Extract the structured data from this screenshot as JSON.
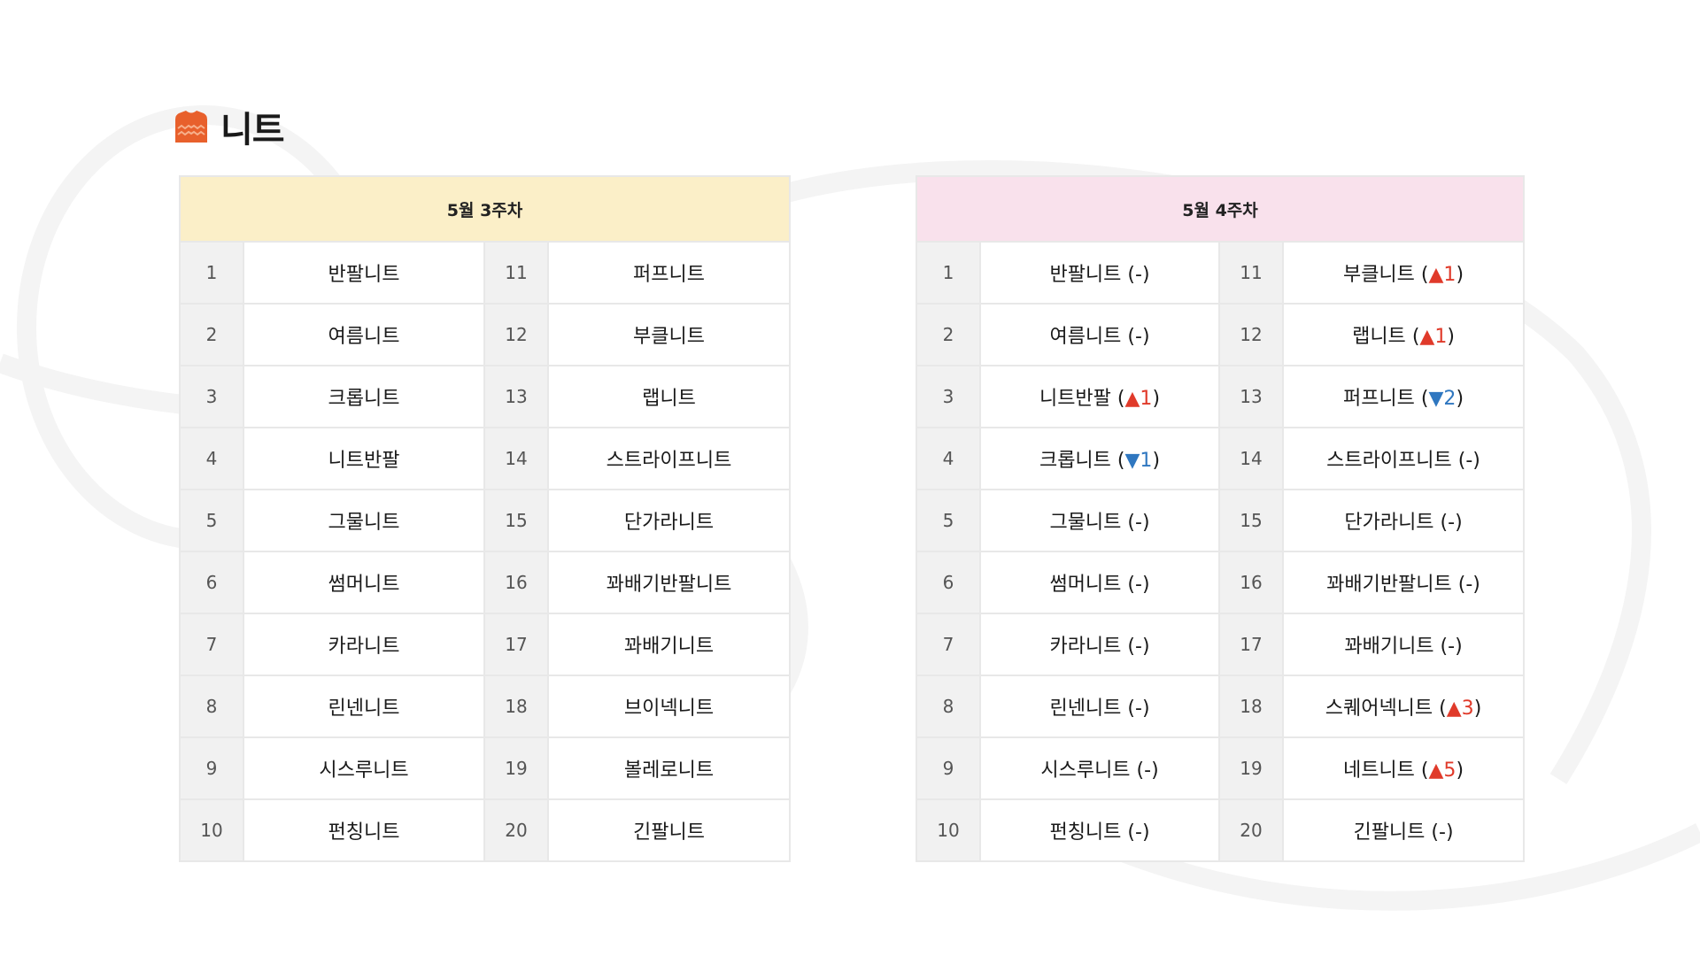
{
  "title": {
    "text": "니트",
    "icon": "sweater-icon"
  },
  "colors": {
    "week1_header_bg": "#fbefc8",
    "week2_header_bg": "#f9e1ec",
    "rank_up": "#e03a2a",
    "rank_down": "#2f77c0",
    "icon": "#e8602c"
  },
  "week1": {
    "header": "5월 3주차",
    "rows": [
      {
        "n1": "1",
        "name1": "반팔니트",
        "n2": "11",
        "name2": "퍼프니트"
      },
      {
        "n1": "2",
        "name1": "여름니트",
        "n2": "12",
        "name2": "부클니트"
      },
      {
        "n1": "3",
        "name1": "크롭니트",
        "n2": "13",
        "name2": "랩니트"
      },
      {
        "n1": "4",
        "name1": "니트반팔",
        "n2": "14",
        "name2": "스트라이프니트"
      },
      {
        "n1": "5",
        "name1": "그물니트",
        "n2": "15",
        "name2": "단가라니트"
      },
      {
        "n1": "6",
        "name1": "썸머니트",
        "n2": "16",
        "name2": "꽈배기반팔니트"
      },
      {
        "n1": "7",
        "name1": "카라니트",
        "n2": "17",
        "name2": "꽈배기니트"
      },
      {
        "n1": "8",
        "name1": "린넨니트",
        "n2": "18",
        "name2": "브이넥니트"
      },
      {
        "n1": "9",
        "name1": "시스루니트",
        "n2": "19",
        "name2": "볼레로니트"
      },
      {
        "n1": "10",
        "name1": "펀칭니트",
        "n2": "20",
        "name2": "긴팔니트"
      }
    ]
  },
  "week2": {
    "header": "5월 4주차",
    "rows": [
      {
        "n1": "1",
        "name1": "반팔니트",
        "c1": {
          "type": "same",
          "text": "(-)"
        },
        "n2": "11",
        "name2": "부클니트",
        "c2": {
          "type": "up",
          "text": "▲1"
        }
      },
      {
        "n1": "2",
        "name1": "여름니트",
        "c1": {
          "type": "same",
          "text": "(-)"
        },
        "n2": "12",
        "name2": "랩니트",
        "c2": {
          "type": "up",
          "text": "▲1"
        }
      },
      {
        "n1": "3",
        "name1": "니트반팔",
        "c1": {
          "type": "up",
          "text": "▲1"
        },
        "n2": "13",
        "name2": "퍼프니트",
        "c2": {
          "type": "down",
          "text": "▼2"
        }
      },
      {
        "n1": "4",
        "name1": "크롭니트",
        "c1": {
          "type": "down",
          "text": "▼1"
        },
        "n2": "14",
        "name2": "스트라이프니트",
        "c2": {
          "type": "same",
          "text": "(-)"
        }
      },
      {
        "n1": "5",
        "name1": "그물니트",
        "c1": {
          "type": "same",
          "text": "(-)"
        },
        "n2": "15",
        "name2": "단가라니트",
        "c2": {
          "type": "same",
          "text": "(-)"
        }
      },
      {
        "n1": "6",
        "name1": "썸머니트",
        "c1": {
          "type": "same",
          "text": "(-)"
        },
        "n2": "16",
        "name2": "꽈배기반팔니트",
        "c2": {
          "type": "same",
          "text": "(-)"
        }
      },
      {
        "n1": "7",
        "name1": "카라니트",
        "c1": {
          "type": "same",
          "text": "(-)"
        },
        "n2": "17",
        "name2": "꽈배기니트",
        "c2": {
          "type": "same",
          "text": "(-)"
        }
      },
      {
        "n1": "8",
        "name1": "린넨니트",
        "c1": {
          "type": "same",
          "text": "(-)"
        },
        "n2": "18",
        "name2": "스퀘어넥니트",
        "c2": {
          "type": "up",
          "text": "▲3"
        }
      },
      {
        "n1": "9",
        "name1": "시스루니트",
        "c1": {
          "type": "same",
          "text": "(-)"
        },
        "n2": "19",
        "name2": "네트니트",
        "c2": {
          "type": "up",
          "text": "▲5"
        }
      },
      {
        "n1": "10",
        "name1": "펀칭니트",
        "c1": {
          "type": "same",
          "text": "(-)"
        },
        "n2": "20",
        "name2": "긴팔니트",
        "c2": {
          "type": "same",
          "text": "(-)"
        }
      }
    ]
  }
}
